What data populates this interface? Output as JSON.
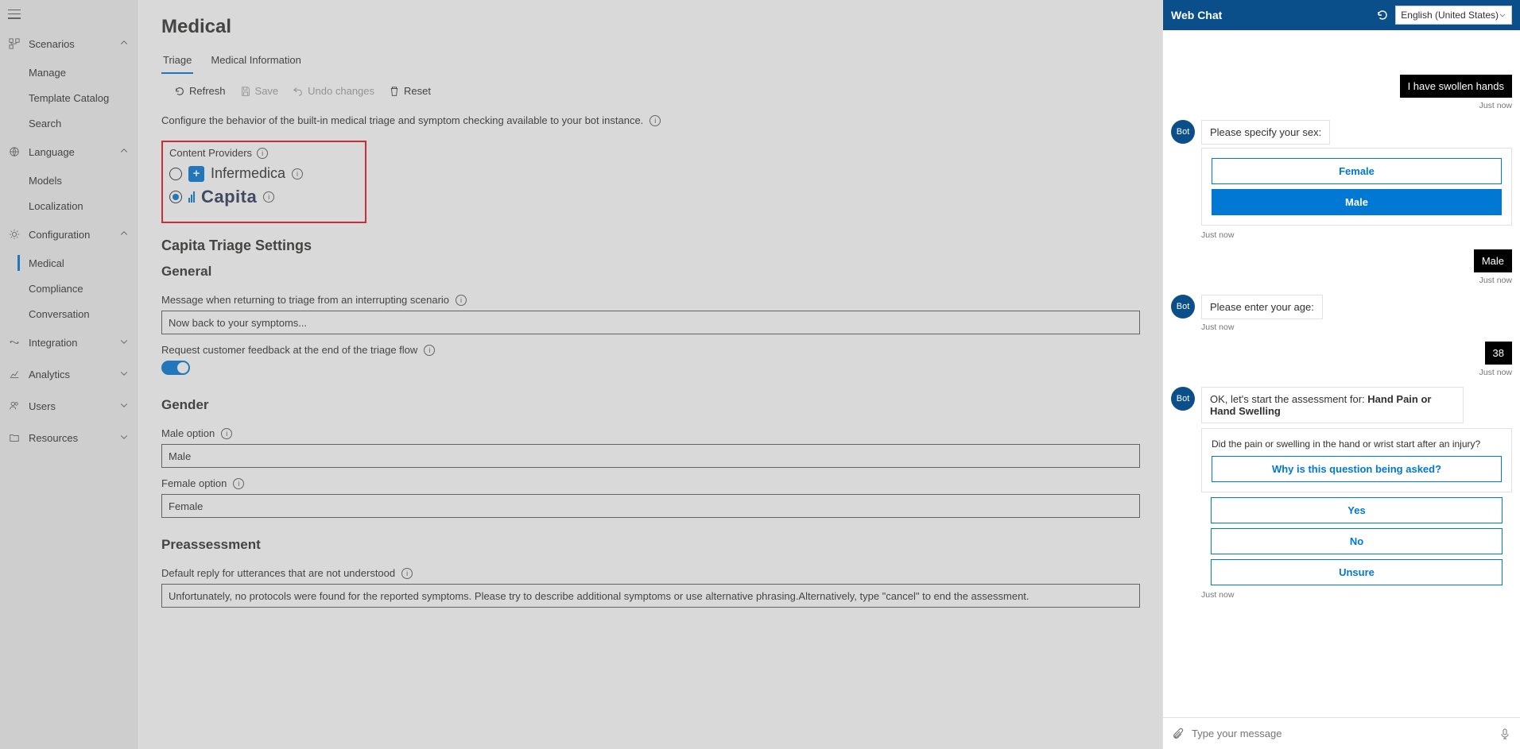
{
  "sidebar": {
    "groups": [
      {
        "label": "Scenarios",
        "expanded": true,
        "items": [
          "Manage",
          "Template Catalog",
          "Search"
        ]
      },
      {
        "label": "Language",
        "expanded": true,
        "items": [
          "Models",
          "Localization"
        ]
      },
      {
        "label": "Configuration",
        "expanded": true,
        "items": [
          "Medical",
          "Compliance",
          "Conversation"
        ],
        "selected": "Medical"
      },
      {
        "label": "Integration",
        "expanded": false,
        "items": []
      },
      {
        "label": "Analytics",
        "expanded": false,
        "items": []
      },
      {
        "label": "Users",
        "expanded": false,
        "items": []
      },
      {
        "label": "Resources",
        "expanded": false,
        "items": []
      }
    ]
  },
  "page": {
    "title": "Medical",
    "tabs": {
      "triage": "Triage",
      "medinfo": "Medical Information",
      "active": "triage"
    },
    "toolbar": {
      "refresh": "Refresh",
      "save": "Save",
      "undo": "Undo changes",
      "reset": "Reset"
    },
    "description": "Configure the behavior of the built-in medical triage and symptom checking available to your bot instance.",
    "content_providers": {
      "label": "Content Providers",
      "infermedica": "Infermedica",
      "capita": "Capita",
      "selected": "capita"
    },
    "capita_heading": "Capita Triage Settings",
    "general_heading": "General",
    "return_msg_label": "Message when returning to triage from an interrupting scenario",
    "return_msg_value": "Now back to your symptoms...",
    "feedback_label": "Request customer feedback at the end of the triage flow",
    "feedback_on": true,
    "gender_heading": "Gender",
    "male_label": "Male option",
    "male_value": "Male",
    "female_label": "Female option",
    "female_value": "Female",
    "preassessment_heading": "Preassessment",
    "default_reply_label": "Default reply for utterances that are not understood",
    "default_reply_value": "Unfortunately, no protocols were found for the reported symptoms. Please try to describe additional symptoms or use alternative phrasing.Alternatively, type \"cancel\" to end the assessment."
  },
  "chat": {
    "title": "Web Chat",
    "language": "English (United States)",
    "bot_label": "Bot",
    "just_now": "Just now",
    "m1_user": "I have swollen hands",
    "m2_bot": "Please specify your sex:",
    "m2_opts": {
      "female": "Female",
      "male": "Male"
    },
    "m3_user": "Male",
    "m4_bot": "Please enter your age:",
    "m5_user": "38",
    "m6_prefix": "OK, let's start the assessment for: ",
    "m6_emph": "Hand Pain or Hand Swelling",
    "m7_q": "Did the pain or swelling in the hand or wrist start after an injury?",
    "m7_why": "Why is this question being asked?",
    "m7_opts": {
      "yes": "Yes",
      "no": "No",
      "unsure": "Unsure"
    },
    "input_placeholder": "Type your message"
  }
}
